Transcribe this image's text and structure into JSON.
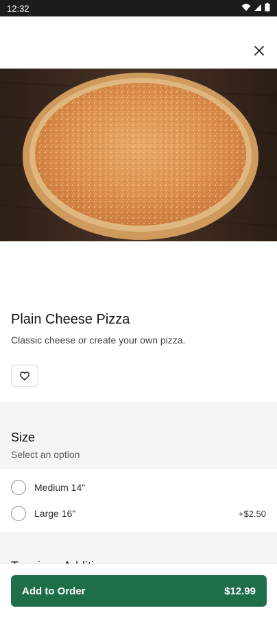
{
  "status_bar": {
    "time": "12:32",
    "icons": [
      "wifi-icon",
      "signal-icon",
      "battery-icon"
    ]
  },
  "header": {
    "close_icon": "close-icon"
  },
  "product": {
    "title": "Plain Cheese Pizza",
    "description": "Classic cheese or create your own pizza.",
    "favorite_icon": "heart-icon"
  },
  "size_section": {
    "title": "Size",
    "subtitle": "Select an option",
    "options": [
      {
        "label": "Medium 14\"",
        "price": ""
      },
      {
        "label": "Large 16\"",
        "price": "+$2.50"
      }
    ]
  },
  "next_section": {
    "title": "Toppings Addition"
  },
  "footer": {
    "add_label": "Add to Order",
    "price": "$12.99"
  },
  "colors": {
    "primary_button": "#1f6e4a",
    "section_bg": "#f5f5f5",
    "status_bar": "#1c1c1c"
  }
}
